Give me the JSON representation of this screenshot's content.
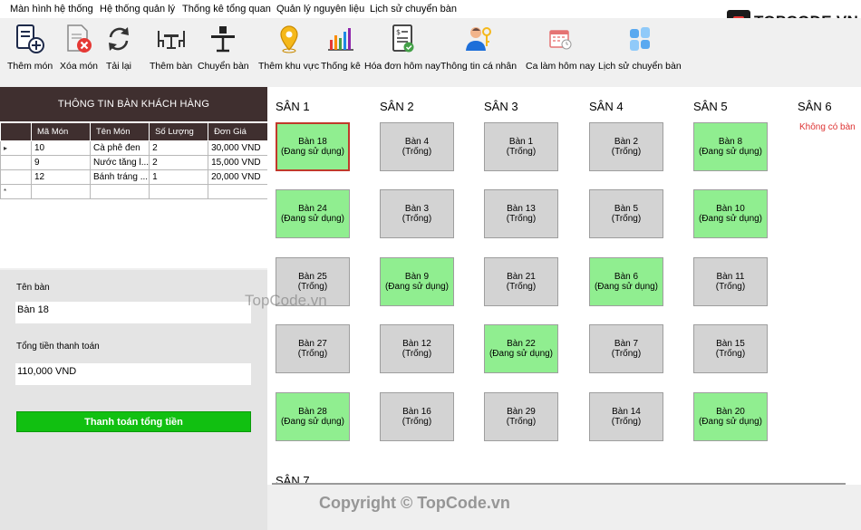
{
  "menu": [
    "Màn hình hệ thống",
    "Hệ thống quản lý",
    "Thống kê tổng quan",
    "Quản lý nguyên liệu",
    "Lịch sử chuyển bàn"
  ],
  "logo": {
    "text": "TOPCODE.VN"
  },
  "toolbar": [
    {
      "label": "Thêm món",
      "icon": "add-dish-icon"
    },
    {
      "label": "Xóa món",
      "icon": "delete-dish-icon"
    },
    {
      "label": "Tải lại",
      "icon": "refresh-icon"
    },
    {
      "label": "Thêm bàn",
      "icon": "add-table-icon"
    },
    {
      "label": "Chuyển bàn",
      "icon": "move-table-icon"
    },
    {
      "label": "Thêm khu vực",
      "icon": "location-icon"
    },
    {
      "label": "Thống kê",
      "icon": "chart-icon"
    },
    {
      "label": "Hóa đơn hôm nay",
      "icon": "invoice-icon"
    },
    {
      "label": "Thông tin cá nhân",
      "icon": "user-key-icon"
    },
    {
      "label": "Ca làm hôm nay",
      "icon": "calendar-icon"
    },
    {
      "label": "Lịch sử chuyển bàn",
      "icon": "history-icon"
    }
  ],
  "panel": {
    "title": "THÔNG TIN BÀN KHÁCH HÀNG",
    "columns": [
      "Mã Món",
      "Tên Món",
      "Số Lượng",
      "Đơn Giá"
    ],
    "rows": [
      [
        "10",
        "Cà phê đen",
        "2",
        "30,000 VND"
      ],
      [
        "9",
        "Nước tăng l...",
        "2",
        "15,000 VND"
      ],
      [
        "12",
        "Bánh tráng ...",
        "1",
        "20,000 VND"
      ]
    ],
    "row_markers": [
      "▸",
      "",
      "",
      "*"
    ],
    "table_name_label": "Tên bàn",
    "table_name_value": "Bàn 18",
    "total_label": "Tổng tiền thanh toán",
    "total_value": "110,000 VND",
    "pay_button": "Thanh toán tổng tiền"
  },
  "areas": [
    {
      "name": "SÂN 1",
      "tables": [
        {
          "name": "Bàn 18",
          "status": "(Đang sử dụng)",
          "busy": true,
          "selected": true
        },
        {
          "name": "Bàn 24",
          "status": "(Đang sử dụng)",
          "busy": true
        },
        {
          "name": "Bàn 25",
          "status": "(Trống)",
          "busy": false
        },
        {
          "name": "Bàn 27",
          "status": "(Trống)",
          "busy": false
        },
        {
          "name": "Bàn 28",
          "status": "(Đang sử dụng)",
          "busy": true
        }
      ]
    },
    {
      "name": "SÂN 2",
      "tables": [
        {
          "name": "Bàn 4",
          "status": "(Trống)",
          "busy": false
        },
        {
          "name": "Bàn 3",
          "status": "(Trống)",
          "busy": false
        },
        {
          "name": "Bàn 9",
          "status": "(Đang sử dụng)",
          "busy": true
        },
        {
          "name": "Bàn 12",
          "status": "(Trống)",
          "busy": false
        },
        {
          "name": "Bàn 16",
          "status": "(Trống)",
          "busy": false
        }
      ]
    },
    {
      "name": "SÂN 3",
      "tables": [
        {
          "name": "Bàn 1",
          "status": "(Trống)",
          "busy": false
        },
        {
          "name": "Bàn 13",
          "status": "(Trống)",
          "busy": false
        },
        {
          "name": "Bàn 21",
          "status": "(Trống)",
          "busy": false
        },
        {
          "name": "Bàn 22",
          "status": "(Đang sử dụng)",
          "busy": true
        },
        {
          "name": "Bàn 29",
          "status": "(Trống)",
          "busy": false
        }
      ]
    },
    {
      "name": "SÂN 4",
      "tables": [
        {
          "name": "Bàn 2",
          "status": "(Trống)",
          "busy": false
        },
        {
          "name": "Bàn 5",
          "status": "(Trống)",
          "busy": false
        },
        {
          "name": "Bàn 6",
          "status": "(Đang sử dụng)",
          "busy": true
        },
        {
          "name": "Bàn 7",
          "status": "(Trống)",
          "busy": false
        },
        {
          "name": "Bàn 14",
          "status": "(Trống)",
          "busy": false
        }
      ]
    },
    {
      "name": "SÂN 5",
      "tables": [
        {
          "name": "Bàn 8",
          "status": "(Đang sử dụng)",
          "busy": true
        },
        {
          "name": "Bàn 10",
          "status": "(Đang sử dụng)",
          "busy": true
        },
        {
          "name": "Bàn 11",
          "status": "(Trống)",
          "busy": false
        },
        {
          "name": "Bàn 15",
          "status": "(Trống)",
          "busy": false
        },
        {
          "name": "Bàn 20",
          "status": "(Đang sử dụng)",
          "busy": true
        }
      ]
    },
    {
      "name": "SÂN 6",
      "tables": [],
      "empty_text": "Không có bàn"
    }
  ],
  "next_area": "SÂN 7",
  "watermarks": [
    "TopCode.vn",
    "Copyright © TopCode.vn"
  ],
  "colors": {
    "busy": "#90ee90",
    "free": "#d3d3d3",
    "header": "#3f2f2f",
    "pay": "#11c011",
    "selected_border": "#c0392b",
    "empty_text": "#dd3333"
  }
}
